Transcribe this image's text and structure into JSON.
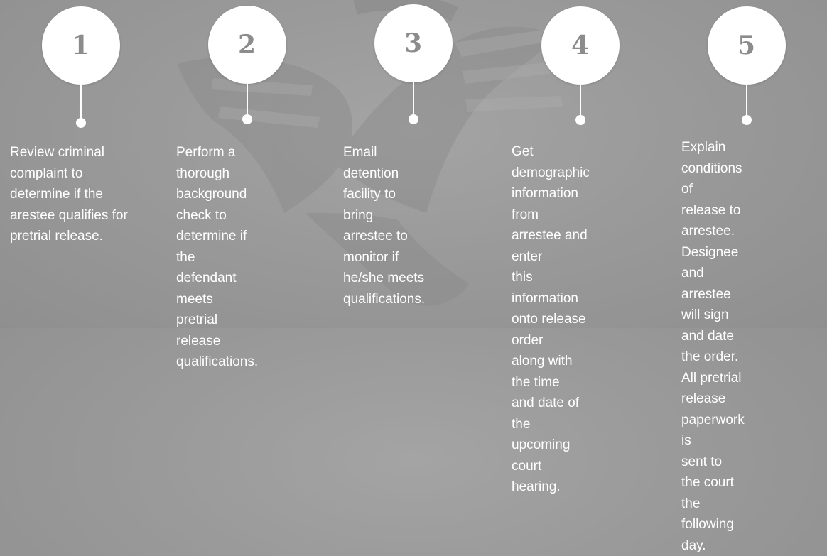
{
  "steps": [
    {
      "number": "1",
      "text": "Review criminal\ncomplaint to\ndetermine if the\narestee qualifies for\npretrial release."
    },
    {
      "number": "2",
      "text": "Perform a thorough\nbackground check to\ndetermine if the\ndefendant meets\npretrial release\nqualifications."
    },
    {
      "number": "3",
      "text": "Email detention\nfacility to bring\narrestee to monitor if\nhe/she meets\nqualifications."
    },
    {
      "number": "4",
      "text": "Get demographic\ninformation from\narrestee and enter\nthis  information\nonto release order\nalong with the time\nand date of the\nupcoming court\nhearing."
    },
    {
      "number": "5",
      "text": "Explain conditions of\nrelease to arrestee.\nDesignee and\narrestee will  sign\nand date the order.\nAll pretrial\nrelease paperwork is\nsent to the court the\nfollowing day."
    }
  ],
  "colors": {
    "background": "#9a9a9a",
    "circle": "#ffffff",
    "number": "#8c8c8c",
    "text": "#ffffff"
  }
}
